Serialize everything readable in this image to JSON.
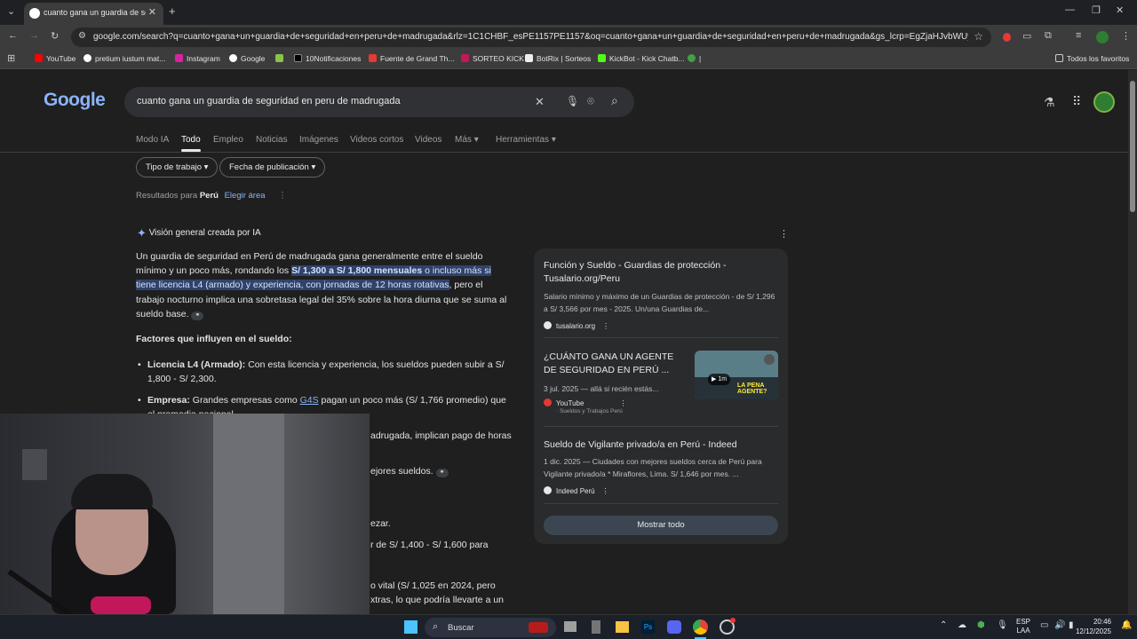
{
  "browser": {
    "tab_title": "cuanto gana un guardia de seg",
    "url": "google.com/search?q=cuanto+gana+un+guardia+de+seguridad+en+peru+de+madrugada&rlz=1C1CHBF_esPE1157PE1157&oq=cuanto+gana+un+guardia+de+seguridad+en+peru+de+madrugada&gs_lcrp=EgZjaHJvbWUyBggAEEUY...",
    "bookmarks": [
      "YouTube",
      "pretium iustum mat...",
      "Instagram",
      "Google",
      "10Notificaciones",
      "Fuente de Grand Th...",
      "SORTEO KICK",
      "BotRix | Sorteos",
      "KickBot - Kick Chatb...",
      "|"
    ],
    "all_bookmarks": "Todos los favoritos"
  },
  "google": {
    "logo": "Google",
    "query": "cuanto gana un guardia de seguridad en peru de madrugada",
    "tabs": [
      "Modo IA",
      "Todo",
      "Empleo",
      "Noticias",
      "Imágenes",
      "Videos cortos",
      "Videos",
      "Más",
      "Herramientas"
    ],
    "chips": [
      "Tipo de trabajo",
      "Fecha de publicación"
    ],
    "results_for": "Resultados para",
    "region": "Perú",
    "choose_area": "Elegir área"
  },
  "ai": {
    "header": "Visión general creada por IA",
    "p1_a": "Un guardia de seguridad en Perú de madrugada gana generalmente entre el sueldo mínimo y un poco más, rondando los ",
    "p1_b": "S/ 1,300 a S/ 1,800 mensuales",
    "p1_c": " o incluso más si tiene licencia L4 (armado) y experiencia, con jornadas de 12 horas rotativas",
    "p1_d": ", pero el trabajo nocturno implica una sobretasa legal del 35% sobre la hora diurna que se suma al sueldo base.",
    "factors_title": "Factores que influyen en el sueldo:",
    "f1_b": "Licencia L4 (Armado):",
    "f1_t": " Con esta licencia y experiencia, los sueldos pueden subir a S/ 1,800 - S/ 2,300.",
    "f2_b": "Empresa:",
    "f2_t1": " Grandes empresas como ",
    "f2_link": "G4S",
    "f2_t2": " pagan un poco más (S/ 1,766 promedio) que el promedio nacional.",
    "frag1": "adrugada, implican pago de horas",
    "frag2": "ejores sueldos.",
    "frag3": "ezar.",
    "frag4": "r de S/ 1,400 - S/ 1,600 para",
    "frag5": "o vital (S/ 1,025 en 2024, pero",
    "frag6": "xtras, lo que podría llevarte a un"
  },
  "sources": [
    {
      "title": "Función y Sueldo - Guardias de protección - Tusalario.org/Peru",
      "desc": "Salario mínimo y máximo de un Guardias de protección - de S/ 1,296 a S/ 3,566 por mes - 2025. Un/una Guardias de...",
      "site": "tusalario.org"
    },
    {
      "title": "¿CUÁNTO GANA UN AGENTE DE SEGURIDAD EN PERÚ ...",
      "desc": "3 jul. 2025 — allá si recién estás...",
      "site": "YouTube",
      "sub": "· Sueldos y Trabajos Perú",
      "duration": "1m",
      "thumb_text": "LA PENA AGENTE?"
    },
    {
      "title": "Sueldo de Vigilante privado/a en Perú - Indeed",
      "desc": "1 dic. 2025 — Ciudades con mejores sueldos cerca de Perú para Vigilante privado/a * Miraflores, Lima. S/ 1,646 por mes. ...",
      "site": "Indeed Perú"
    }
  ],
  "show_all": "Mostrar todo",
  "taskbar": {
    "search": "Buscar",
    "lang1": "ESP",
    "lang2": "LAA",
    "time": "20:46",
    "date": "12/12/2025"
  }
}
